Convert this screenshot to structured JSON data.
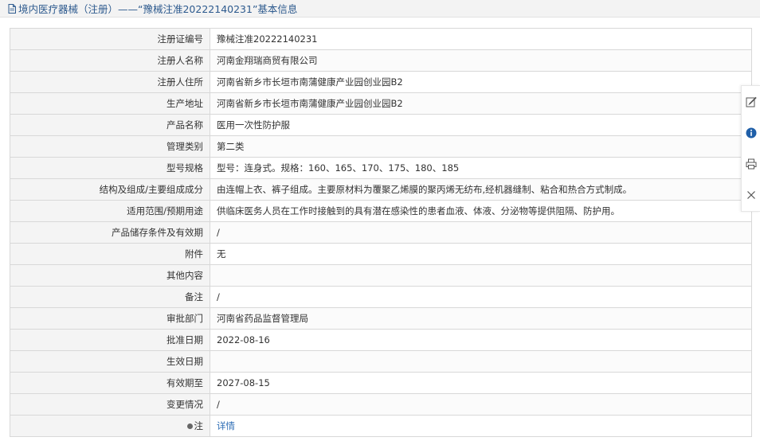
{
  "header": {
    "title": "境内医疗器械（注册）——“豫械注准20222140231”基本信息"
  },
  "rows": [
    {
      "label": "注册证编号",
      "value": "豫械注准20222140231"
    },
    {
      "label": "注册人名称",
      "value": "河南金翔瑞商贸有限公司"
    },
    {
      "label": "注册人住所",
      "value": "河南省新乡市长垣市南蒲健康产业园创业园B2"
    },
    {
      "label": "生产地址",
      "value": "河南省新乡市长垣市南蒲健康产业园创业园B2"
    },
    {
      "label": "产品名称",
      "value": "医用一次性防护服"
    },
    {
      "label": "管理类别",
      "value": "第二类"
    },
    {
      "label": "型号规格",
      "value": "型号：连身式。规格：160、165、170、175、180、185"
    },
    {
      "label": "结构及组成/主要组成成分",
      "value": "由连帽上衣、裤子组成。主要原材料为覆聚乙烯膜的聚丙烯无纺布,经机器缝制、粘合和热合方式制成。"
    },
    {
      "label": "适用范围/预期用途",
      "value": "供临床医务人员在工作时接触到的具有潜在感染性的患者血液、体液、分泌物等提供阻隔、防护用。"
    },
    {
      "label": "产品储存条件及有效期",
      "value": "/"
    },
    {
      "label": "附件",
      "value": "无"
    },
    {
      "label": "其他内容",
      "value": ""
    },
    {
      "label": "备注",
      "value": "/"
    },
    {
      "label": "审批部门",
      "value": "河南省药品监督管理局"
    },
    {
      "label": "批准日期",
      "value": "2022-08-16"
    },
    {
      "label": "生效日期",
      "value": ""
    },
    {
      "label": "有效期至",
      "value": "2027-08-15"
    },
    {
      "label": "变更情况",
      "value": "/"
    }
  ],
  "note_row": {
    "label": "注",
    "link_text": "详情"
  },
  "toolbar": {
    "icons": [
      "edit-icon",
      "info-icon",
      "print-icon",
      "close-icon"
    ]
  },
  "colors": {
    "title_text": "#2d5a8e",
    "link": "#2d6db5",
    "label_bg": "#f4f4f4",
    "info_icon": "#1f5fa8"
  }
}
